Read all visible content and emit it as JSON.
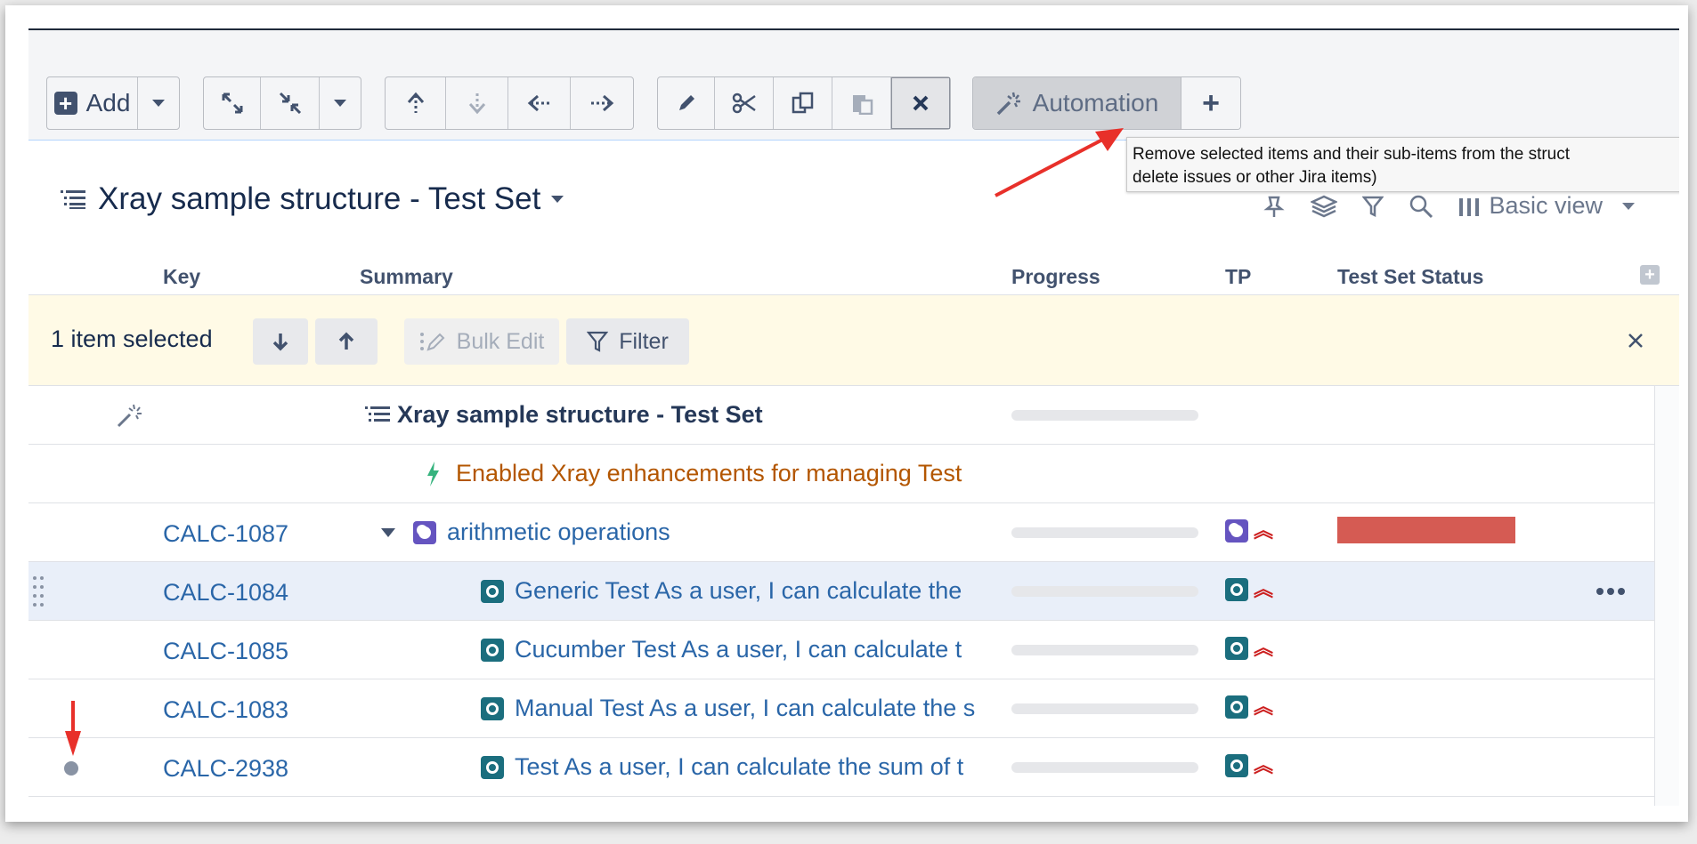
{
  "toolbar": {
    "add_label": "Add",
    "automation_label": "Automation"
  },
  "tooltip": {
    "line1": "Remove selected items and their sub-items from the struct",
    "line2": "delete issues or other Jira items)"
  },
  "structure": {
    "title": "Xray sample structure - Test Set",
    "view_label": "Basic view"
  },
  "columns": {
    "key": "Key",
    "summary": "Summary",
    "progress": "Progress",
    "tp": "TP",
    "status": "Test Set Status"
  },
  "selection": {
    "count_label": "1 item selected",
    "bulk_edit": "Bulk Edit",
    "filter": "Filter"
  },
  "rows": [
    {
      "key": "",
      "summary": "Xray sample structure - Test Set"
    },
    {
      "key": "",
      "summary": "Enabled Xray enhancements for managing Test"
    },
    {
      "key": "CALC-1087",
      "summary": "arithmetic operations"
    },
    {
      "key": "CALC-1084",
      "summary": "Generic Test As a user, I can calculate the"
    },
    {
      "key": "CALC-1085",
      "summary": "Cucumber Test As a user, I can calculate t"
    },
    {
      "key": "CALC-1083",
      "summary": "Manual Test As a user, I can calculate the s"
    },
    {
      "key": "CALC-2938",
      "summary": "Test As a user, I can calculate the sum of t"
    }
  ],
  "colors": {
    "link": "#2a66a8",
    "status_bar": "#d55b53",
    "priority": "#cc1e1e",
    "selection_bg": "#fffae6"
  }
}
